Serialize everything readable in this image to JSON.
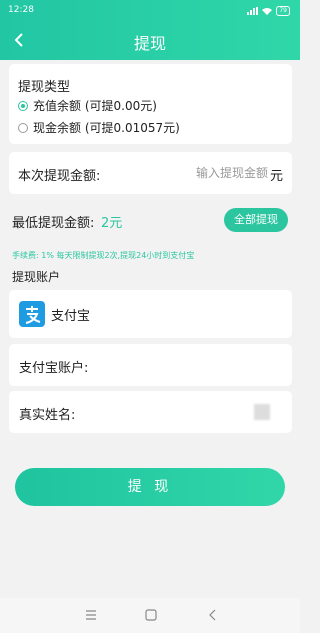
{
  "status_bar": {
    "time": "12:28",
    "battery": "79"
  },
  "header": {
    "title": "提现"
  },
  "withdraw_type": {
    "title": "提现类型",
    "options": [
      {
        "label": "充值余额 (可提0.00元)",
        "selected": true
      },
      {
        "label": "现金余额 (可提0.01057元)",
        "selected": false
      }
    ]
  },
  "amount": {
    "label": "本次提现金额:",
    "placeholder": "输入提现金额",
    "unit": "元"
  },
  "minimum": {
    "label": "最低提现金额:",
    "value": "2元",
    "all_button": "全部提现"
  },
  "fee_note": "手续费: 1% 每天限制提现2次,提现24小时到支付宝",
  "account": {
    "heading": "提现账户",
    "method_name": "支付宝",
    "account_label": "支付宝账户:",
    "name_label": "真实姓名:"
  },
  "submit_button": "提 现",
  "colors": {
    "accent": "#2bc6a0",
    "alipay_blue": "#1f9be2"
  },
  "icons": [
    "back-arrow-icon",
    "signal-icon",
    "wifi-icon",
    "battery-icon",
    "alipay-icon",
    "menu-icon",
    "home-icon",
    "back-triangle-icon"
  ]
}
